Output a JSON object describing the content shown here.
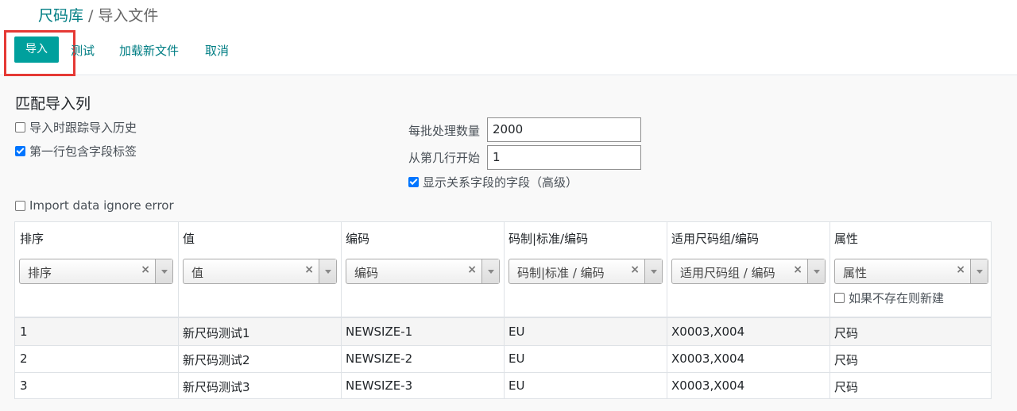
{
  "breadcrumb": {
    "parent": "尺码库",
    "separator": "/",
    "current": "导入文件"
  },
  "toolbar": {
    "import_label": "导入",
    "test_label": "测试",
    "reload_label": "加载新文件",
    "cancel_label": "取消"
  },
  "section_title": "匹配导入列",
  "options": {
    "track_history": {
      "label": "导入时跟踪导入历史",
      "checked": false
    },
    "first_row_headers": {
      "label": "第一行包含字段标签",
      "checked": true
    },
    "batch_size_label": "每批处理数量",
    "batch_size_value": "2000",
    "start_row_label": "从第几行开始",
    "start_row_value": "1",
    "show_relational": {
      "label": "显示关系字段的字段（高级）",
      "checked": true
    },
    "ignore_error": {
      "label": "Import data ignore error",
      "checked": false
    }
  },
  "table": {
    "columns": [
      {
        "header": "排序",
        "mapped": "排序"
      },
      {
        "header": "值",
        "mapped": "值"
      },
      {
        "header": "编码",
        "mapped": "编码"
      },
      {
        "header": "码制|标准/编码",
        "mapped": "码制|标准 / 编码"
      },
      {
        "header": "适用尺码组/编码",
        "mapped": "适用尺码组 / 编码"
      },
      {
        "header": "属性",
        "mapped": "属性"
      }
    ],
    "create_if_missing_label": "如果不存在则新建",
    "clear_symbol": "×",
    "rows": [
      [
        "1",
        "新尺码测试1",
        "NEWSIZE-1",
        "EU",
        "X0003,X004",
        "尺码"
      ],
      [
        "2",
        "新尺码测试2",
        "NEWSIZE-2",
        "EU",
        "X0003,X004",
        "尺码"
      ],
      [
        "3",
        "新尺码测试3",
        "NEWSIZE-3",
        "EU",
        "X0003,X004",
        "尺码"
      ]
    ]
  },
  "colors": {
    "primary": "#00a09d",
    "link": "#017e84",
    "highlight": "#e53935"
  }
}
